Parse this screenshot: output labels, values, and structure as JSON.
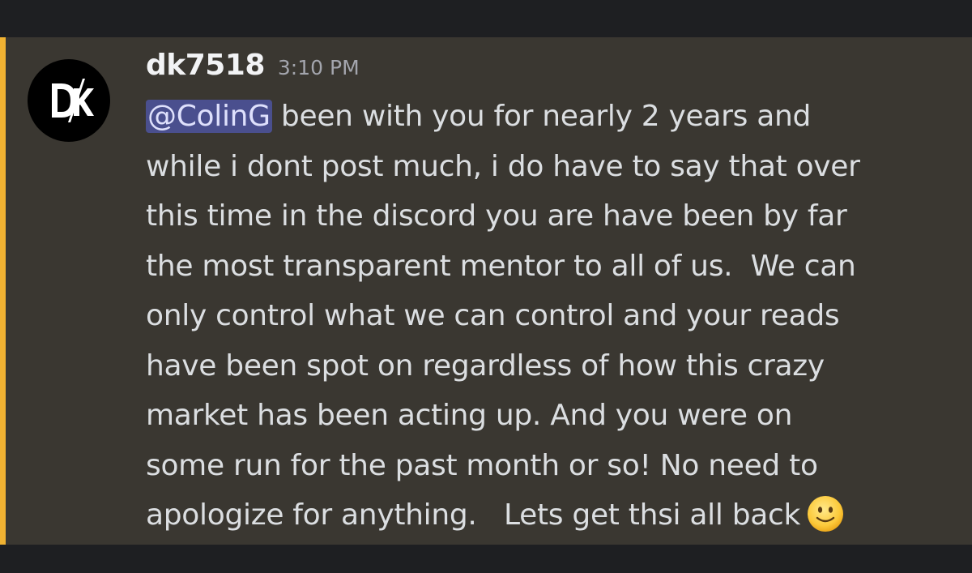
{
  "message": {
    "author": "dk7518",
    "timestamp": "3:10 PM",
    "avatar_initials": "DK",
    "mention": "@ColinG",
    "lines": [
      " been with you for nearly 2 years and",
      "while i dont post much, i do have to say that over",
      "this time in the discord you are have been by far",
      "the most transparent mentor to all of us.  We can",
      "only control what we can control and your reads",
      "have been spot on regardless of how this crazy",
      "market has been acting up. And you were on",
      "some run for the past month or so! No need to",
      "apologize for anything.   Lets get thsi all back"
    ],
    "trailing_emoji": "slightly-smiling-face-emoji"
  },
  "colors": {
    "background": "#1e1f22",
    "message_highlight": "#3a3731",
    "mention_stripe": "#f0b232",
    "mention_bg": "#4a4f8e",
    "text": "#dbdee1"
  }
}
